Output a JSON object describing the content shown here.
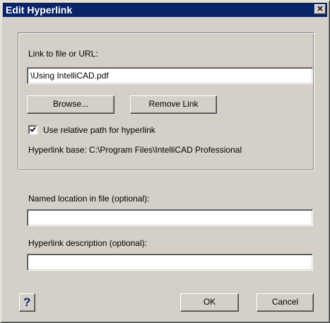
{
  "window": {
    "title": "Edit Hyperlink",
    "close_glyph": "✕"
  },
  "link": {
    "label": "Link to file or URL:",
    "value": "\\Using IntelliCAD.pdf",
    "browse_label": "Browse...",
    "remove_label": "Remove Link",
    "relative_checked": true,
    "relative_label": "Use relative path for hyperlink",
    "base_text": "Hyperlink base: C:\\Program Files\\IntelliCAD Professional"
  },
  "named_location": {
    "label": "Named location in file (optional):",
    "value": ""
  },
  "description": {
    "label": "Hyperlink description (optional):",
    "value": ""
  },
  "footer": {
    "help_glyph": "?",
    "ok_label": "OK",
    "cancel_label": "Cancel"
  },
  "colors": {
    "titlebar": "#0a246a",
    "face": "#d4d0c8"
  }
}
